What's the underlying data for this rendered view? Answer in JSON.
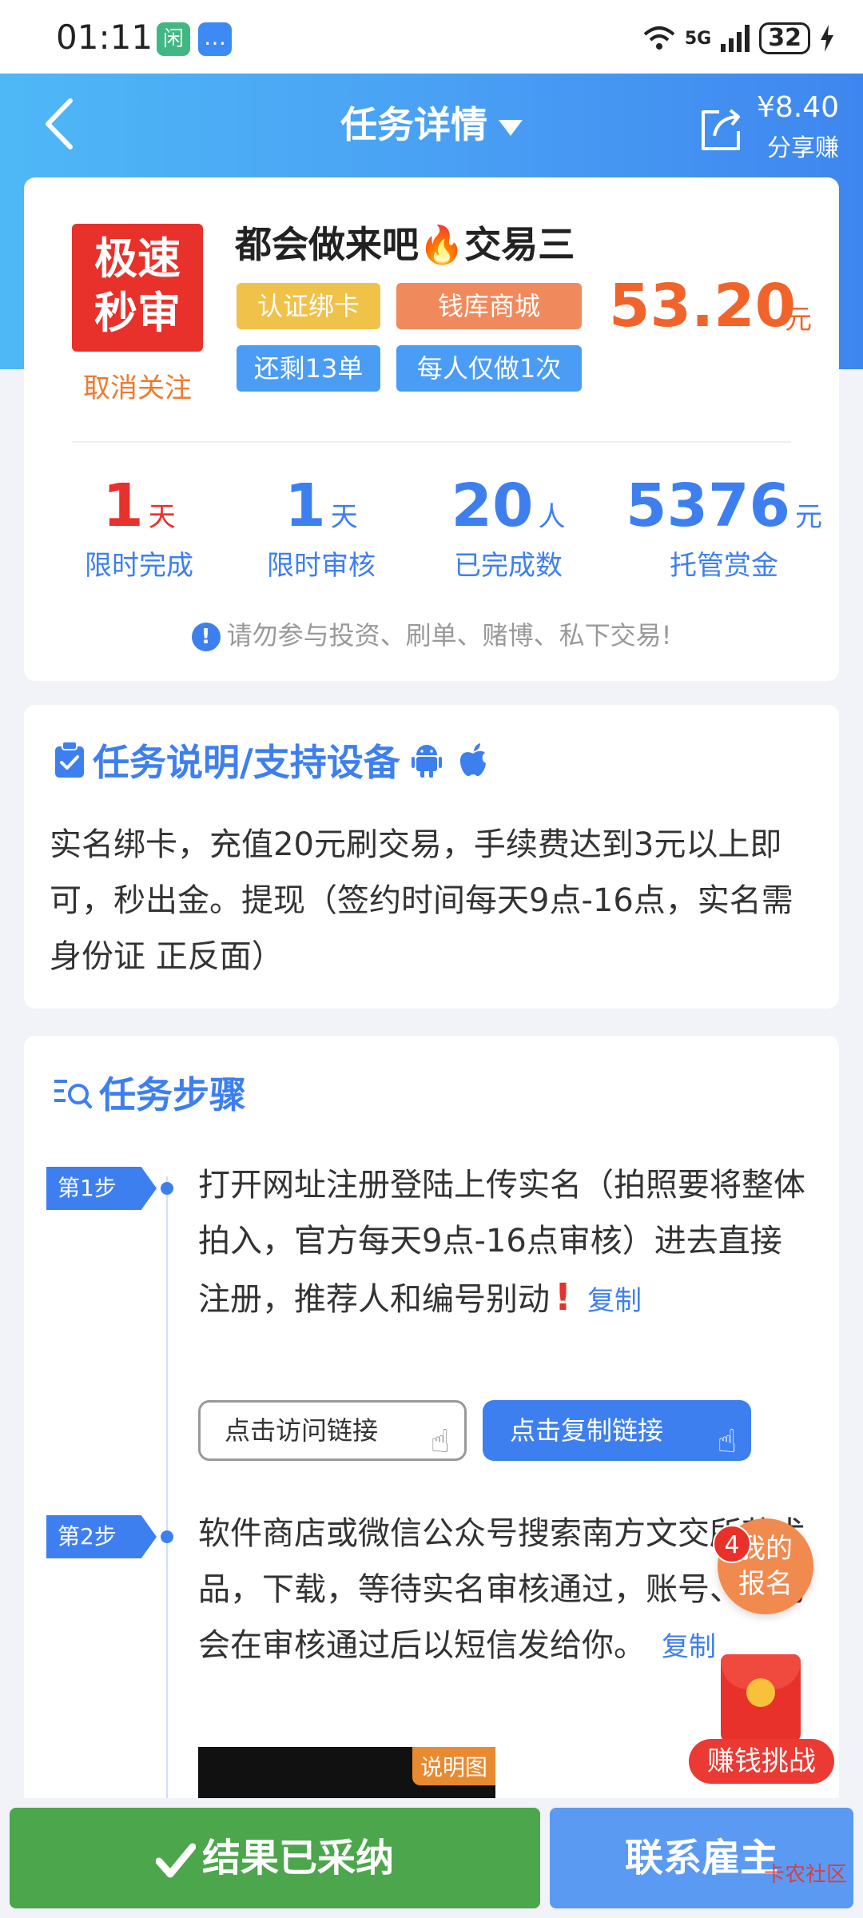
{
  "status_bar": {
    "time": "01:11",
    "app1_glyph": "闲",
    "network": "5G",
    "battery": "32"
  },
  "header": {
    "title": "任务详情",
    "share_amount": "¥8.40",
    "share_label": "分享赚"
  },
  "task": {
    "badge_line1": "极速",
    "badge_line2": "秒审",
    "unfollow": "取消关注",
    "title": "都会做来吧🔥交易三",
    "tags": [
      "认证绑卡",
      "钱库商城",
      "还剩13单",
      "每人仅做1次"
    ],
    "price": "53.20",
    "price_unit": "元",
    "stats": [
      {
        "value": "1",
        "unit": "天",
        "label": "限时完成"
      },
      {
        "value": "1",
        "unit": "天",
        "label": "限时审核"
      },
      {
        "value": "20",
        "unit": "人",
        "label": "已完成数"
      },
      {
        "value": "5376",
        "unit": "元",
        "label": "托管赏金"
      }
    ],
    "warning": "请勿参与投资、刷单、赌博、私下交易!"
  },
  "description": {
    "title": "任务说明/支持设备",
    "text": "实名绑卡，充值20元刷交易，手续费达到3元以上即可，秒出金。提现（签约时间每天9点-16点，实名需身份证 正反面）"
  },
  "steps": {
    "title": "任务步骤",
    "items": [
      {
        "badge": "第1步",
        "text": "打开网址注册登陆上传实名（拍照要将整体拍入，官方每天9点-16点审核）进去直接注册，推荐人和编号别动",
        "copy": "复制",
        "btn_visit": "点击访问链接",
        "btn_copy": "点击复制链接"
      },
      {
        "badge": "第2步",
        "text": "软件商店或微信公众号搜索南方文交所艺术品，下载，等待实名审核通过，账号、密码会在审核通过后以短信发给你。",
        "copy": "复制",
        "image_label": "说明图"
      }
    ]
  },
  "floating": {
    "signup_count": "4",
    "signup_label": "我的报名",
    "earn_label": "赚钱挑战"
  },
  "bottom": {
    "accepted": "结果已采纳",
    "contact": "联系雇主",
    "watermark": "卡农社区"
  },
  "colors": {
    "primary": "#3e7ff0",
    "price": "#f0642b",
    "badge_red": "#e8312a",
    "accepted_green": "#4ca64c"
  }
}
